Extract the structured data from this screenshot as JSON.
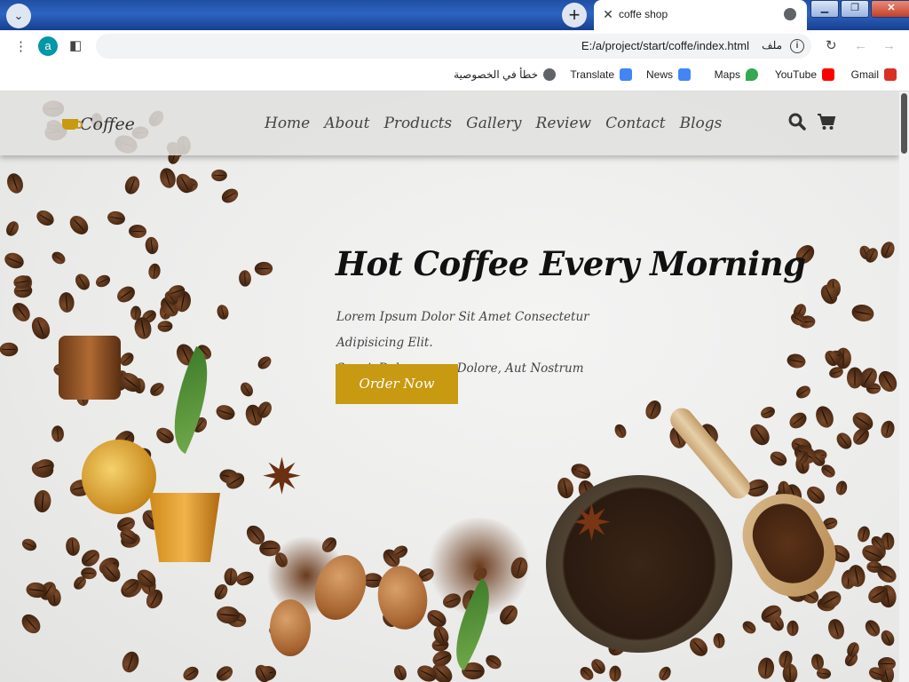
{
  "browser": {
    "tab": {
      "title": "coffe shop"
    },
    "window_buttons": {
      "minimize": "▁",
      "restore": "❐",
      "close": "✕"
    },
    "address_bar": {
      "url": "E:/a/project/start/coffe/index.html",
      "label": "ملف",
      "profile_initial": "a"
    },
    "bookmarks": [
      {
        "label": "Gmail",
        "icon": "gmail-icon",
        "color": "#d93025"
      },
      {
        "label": "YouTube",
        "icon": "youtube-icon",
        "color": "#ff0000"
      },
      {
        "label": "Maps",
        "icon": "maps-icon",
        "color": "#34a853"
      },
      {
        "label": "News",
        "icon": "news-icon",
        "color": "#4285f4"
      },
      {
        "label": "Translate",
        "icon": "translate-icon",
        "color": "#4285f4"
      },
      {
        "label": "خطأ في الخصوصية",
        "icon": "globe-icon",
        "color": "#5f6368"
      }
    ]
  },
  "site": {
    "logo": "Coffee",
    "nav": [
      "Home",
      "About",
      "Products",
      "Gallery",
      "Review",
      "Contact",
      "Blogs"
    ],
    "hero": {
      "title": "Hot Coffee Every Morning",
      "line1": "Lorem Ipsum Dolor Sit Amet Consectetur Adipisicing Elit.",
      "line2": "Sequi, Doloremque Dolore, Aut Nostrum Consequuntur Quis",
      "button": "Order Now"
    },
    "colors": {
      "accent": "#c89a12",
      "text": "#111111"
    }
  }
}
